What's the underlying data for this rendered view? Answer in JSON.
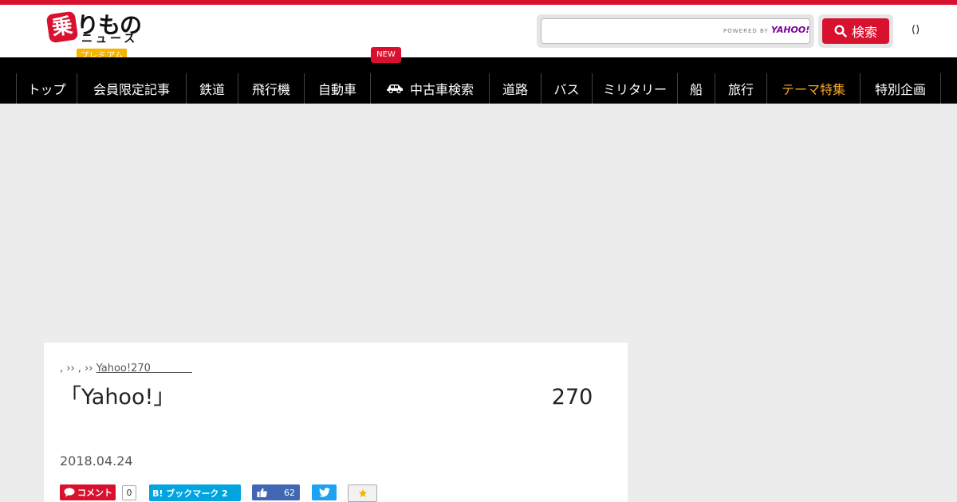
{
  "colors": {
    "brand": "#d8112e",
    "nav_bg": "#000000",
    "highlight": "#f5a623",
    "premium": "#f4b400"
  },
  "logo": {
    "mark": "乗",
    "main": "りもの",
    "sub": "ニュース",
    "premium_badge": "プレミアム"
  },
  "search": {
    "powered_label": "POWERED BY",
    "powered_brand": "YAHOO!",
    "button_label": "検索",
    "value": ""
  },
  "header": {
    "login_text": "()"
  },
  "nav": {
    "new_badge": "NEW",
    "items": [
      {
        "label": "トップ"
      },
      {
        "label": "会員限定記事"
      },
      {
        "label": "鉄道"
      },
      {
        "label": "飛行機"
      },
      {
        "label": "自動車"
      },
      {
        "label": "中古車検索",
        "icon": "car-icon"
      },
      {
        "label": "道路"
      },
      {
        "label": "バス"
      },
      {
        "label": "ミリタリー"
      },
      {
        "label": "船"
      },
      {
        "label": "旅行"
      },
      {
        "label": "テーマ特集",
        "highlight": true
      },
      {
        "label": "特別企画"
      }
    ]
  },
  "article": {
    "breadcrumb_prefix": ", ›› , ››",
    "breadcrumb_link": "Yahoo!270　　　　",
    "title": "「Yahoo!」　　　　　　　　　　　　　　　　　　270　　　　　　　　　　　　　　　",
    "date": "2018.04.24"
  },
  "share": {
    "comment_label": "コメント",
    "comment_count": "0",
    "hatena_label": "B! ブックマーク 2",
    "like_count": "62"
  }
}
